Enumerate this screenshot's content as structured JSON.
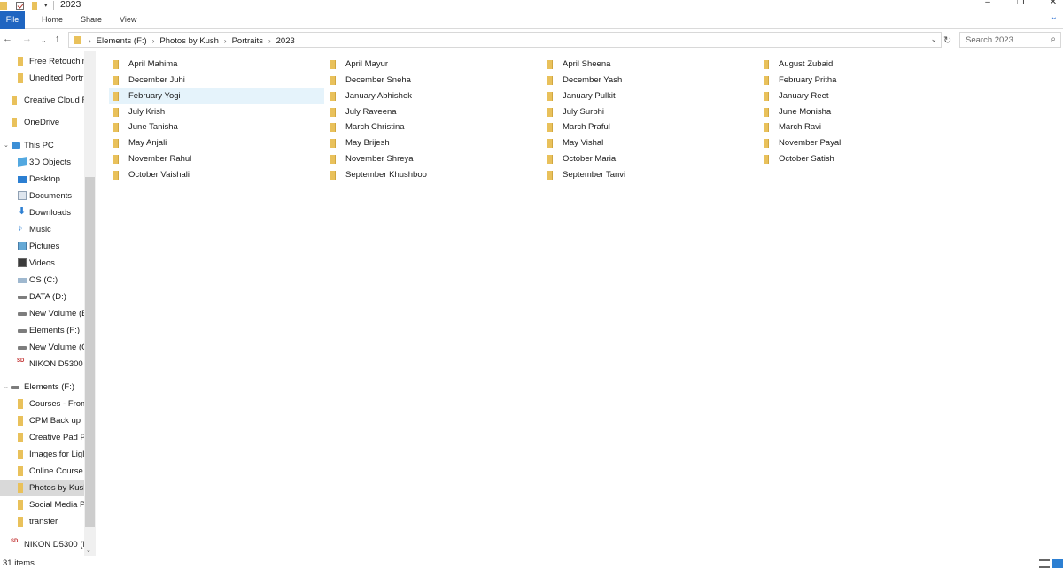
{
  "window": {
    "title": "2023"
  },
  "ribbon": {
    "tabs": [
      {
        "label": "File"
      },
      {
        "label": "Home"
      },
      {
        "label": "Share"
      },
      {
        "label": "View"
      }
    ]
  },
  "address": {
    "breadcrumbs": [
      "Elements (F:)",
      "Photos by Kush",
      "Portraits",
      "2023"
    ]
  },
  "search": {
    "placeholder": "Search 2023"
  },
  "sidebar": {
    "items": [
      {
        "label": "Free Retouchin",
        "icon": "folder-icon"
      },
      {
        "label": "Unedited Portr",
        "icon": "folder-icon"
      },
      {
        "label": "Creative Cloud F",
        "icon": "folder-icon"
      },
      {
        "label": "OneDrive",
        "icon": "folder-icon"
      },
      {
        "label": "This PC",
        "icon": "computer-icon"
      },
      {
        "label": "3D Objects",
        "icon": "3d-objects-icon"
      },
      {
        "label": "Desktop",
        "icon": "desktop-icon"
      },
      {
        "label": "Documents",
        "icon": "documents-icon"
      },
      {
        "label": "Downloads",
        "icon": "downloads-icon"
      },
      {
        "label": "Music",
        "icon": "music-icon"
      },
      {
        "label": "Pictures",
        "icon": "pictures-icon"
      },
      {
        "label": "Videos",
        "icon": "videos-icon"
      },
      {
        "label": "OS (C:)",
        "icon": "os-drive-icon"
      },
      {
        "label": "DATA (D:)",
        "icon": "drive-icon"
      },
      {
        "label": "New Volume (E",
        "icon": "drive-icon"
      },
      {
        "label": "Elements (F:)",
        "icon": "drive-icon"
      },
      {
        "label": "New Volume (C",
        "icon": "drive-icon"
      },
      {
        "label": "NIKON D5300",
        "icon": "sd-card-icon"
      },
      {
        "label": "Elements (F:)",
        "icon": "drive-icon"
      },
      {
        "label": "Courses - From",
        "icon": "folder-icon"
      },
      {
        "label": "CPM Back up",
        "icon": "folder-icon"
      },
      {
        "label": "Creative Pad Pl",
        "icon": "folder-icon"
      },
      {
        "label": "Images for Ligl",
        "icon": "folder-icon"
      },
      {
        "label": "Online Course",
        "icon": "folder-icon"
      },
      {
        "label": "Photos by Kush",
        "icon": "folder-icon",
        "selected": true
      },
      {
        "label": "Social Media P",
        "icon": "folder-icon"
      },
      {
        "label": "transfer",
        "icon": "folder-icon"
      },
      {
        "label": "NIKON D5300 (H",
        "icon": "sd-card-icon"
      }
    ]
  },
  "folders": [
    [
      "April Mahima",
      "December Juhi",
      "February Yogi",
      "July Krish",
      "June Tanisha",
      "May Anjali",
      "November Rahul",
      "October Vaishali"
    ],
    [
      "April Mayur",
      "December Sneha",
      "January Abhishek",
      "July Raveena",
      "March Christina",
      "May Brijesh",
      "November Shreya",
      "September Khushboo"
    ],
    [
      "April Sheena",
      "December Yash",
      "January Pulkit",
      "July Surbhi",
      "March Praful",
      "May Vishal",
      "October Maria",
      "September Tanvi"
    ],
    [
      "August Zubaid",
      "February Pritha",
      "January Reet",
      "June Monisha",
      "March Ravi",
      "November Payal",
      "October Satish"
    ]
  ],
  "selected_folder": "February Yogi",
  "status": {
    "item_count": "31 items"
  },
  "colors": {
    "file_tab": "#1f65c1",
    "folder": "#e9c15b",
    "selection": "#e5f3fb",
    "nav_selection": "#d9d9d9"
  }
}
